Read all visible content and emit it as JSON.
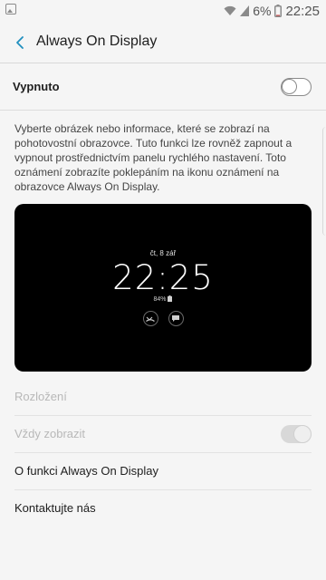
{
  "status_bar": {
    "battery_percent": "6%",
    "time": "22:25"
  },
  "app_bar": {
    "title": "Always On Display"
  },
  "master_switch": {
    "label": "Vypnuto",
    "state": "off"
  },
  "description": "Vyberte obrázek nebo informace, které se zobrazí na pohotovostní obrazovce. Tuto funkci lze rovněž zapnout a vypnout prostřednictvím panelu rychlého nastavení. Toto oznámení zobrazíte poklepáním na ikonu oznámení na obrazovce Always On Display.",
  "preview": {
    "date": "čt, 8 zář",
    "time": "22:25",
    "battery": "84%"
  },
  "settings": {
    "layout_label": "Rozložení",
    "always_show_label": "Vždy zobrazit",
    "about_label": "O funkci Always On Display",
    "contact_label": "Kontaktujte nás"
  },
  "colors": {
    "background": "#f5f5f5",
    "accent": "#1f8fbf",
    "preview_bg": "#000000"
  }
}
